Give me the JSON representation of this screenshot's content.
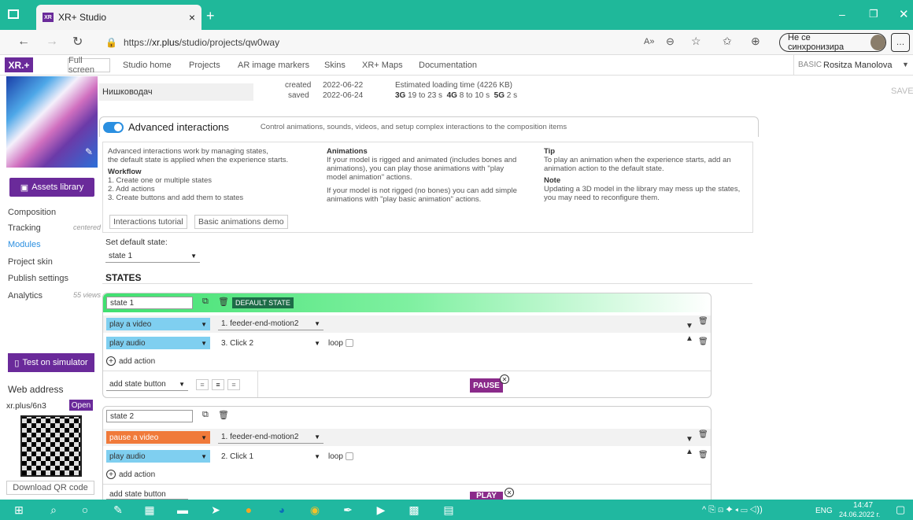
{
  "browser": {
    "tab_title": "XR+ Studio",
    "favicon_text": "XR",
    "url_prefix": "https://",
    "url_host": "xr.plus",
    "url_path": "/studio/projects/qw0way",
    "sync_label": "Не се синхронизира",
    "read_aloud": "A»"
  },
  "nav": {
    "logo": "XR.+",
    "fullscreen": "Full screen",
    "links": [
      "Studio home",
      "Projects",
      "AR image markers",
      "Skins",
      "XR+ Maps",
      "Documentation"
    ],
    "plan": "BASIC",
    "user": "Rositza Manolova"
  },
  "sidebar": {
    "assets_library": "Assets library",
    "items": [
      {
        "label": "Composition",
        "note": ""
      },
      {
        "label": "Tracking",
        "note": "centered"
      },
      {
        "label": "Modules",
        "note": ""
      },
      {
        "label": "Project skin",
        "note": ""
      },
      {
        "label": "Publish settings",
        "note": ""
      },
      {
        "label": "Analytics",
        "note": "55 views"
      }
    ],
    "test_simulator": "Test on simulator",
    "web_address_label": "Web address",
    "short_url": "xr.plus/6n3",
    "open": "Open",
    "download_qr": "Download QR code"
  },
  "project": {
    "name": "Нишководач",
    "created_label": "created",
    "created": "2022-06-22",
    "saved_label": "saved",
    "saved": "2022-06-24",
    "loading_title": "Estimated loading time (4226 KB)",
    "l3g": "3G",
    "l3g_v": "19 to 23 s",
    "l4g": "4G",
    "l4g_v": "8 to 10 s",
    "l5g": "5G",
    "l5g_v": "2 s",
    "save": "SAVE"
  },
  "advanced": {
    "title": "Advanced interactions",
    "subtitle": "Control animations, sounds, videos, and setup complex interactions to the composition items",
    "intro1": "Advanced interactions work by managing states,",
    "intro2": "the default state is applied when the experience starts.",
    "workflow_title": "Workflow",
    "wf1": "1. Create one or multiple states",
    "wf2": "2. Add actions",
    "wf3": "3. Create buttons and add them to states",
    "anim_title": "Animations",
    "anim1": "If your model is rigged and animated (includes bones and",
    "anim2": "animations), you can play those animations with \"play",
    "anim3": "model animation\" actions.",
    "anim4": "If your model is not rigged (no bones) you can add simple",
    "anim5": "animations with \"play basic animation\" actions.",
    "tip_title": "Tip",
    "tip1": "To play an animation when the experience starts, add an",
    "tip2": "animation action to the default state.",
    "note_title": "Note",
    "note1": "Updating a 3D model in the library may mess up the states,",
    "note2": "you may need to reconfigure them.",
    "tutorial_btn": "Interactions tutorial",
    "demo_btn": "Basic animations demo"
  },
  "default_state": {
    "label": "Set default state:",
    "value": "state 1"
  },
  "states_title": "STATES",
  "states": [
    {
      "name": "state 1",
      "badge": "DEFAULT STATE",
      "actions": [
        {
          "type": "play a video",
          "target": "1. feeder-end-motion2",
          "loop": ""
        },
        {
          "type": "play audio",
          "target": "3. Click 2",
          "loop": "loop"
        }
      ],
      "add_action": "add action",
      "add_button": "add state button",
      "button": "PAUSE"
    },
    {
      "name": "state 2",
      "badge": "",
      "actions": [
        {
          "type": "pause a video",
          "target": "1. feeder-end-motion2",
          "loop": ""
        },
        {
          "type": "play audio",
          "target": "2. Click 1",
          "loop": "loop"
        }
      ],
      "add_action": "add action",
      "add_button": "add state button",
      "button": "PLAY"
    }
  ],
  "taskbar": {
    "lang": "ENG",
    "time": "14:47",
    "date": "24.06.2022 г."
  },
  "colors": {
    "brand": "#6a2a9a",
    "titlebar": "#1fb89a",
    "video_action": "#7fcff0",
    "pause_action": "#f07a3a",
    "default_badge": "#1d6b47"
  }
}
